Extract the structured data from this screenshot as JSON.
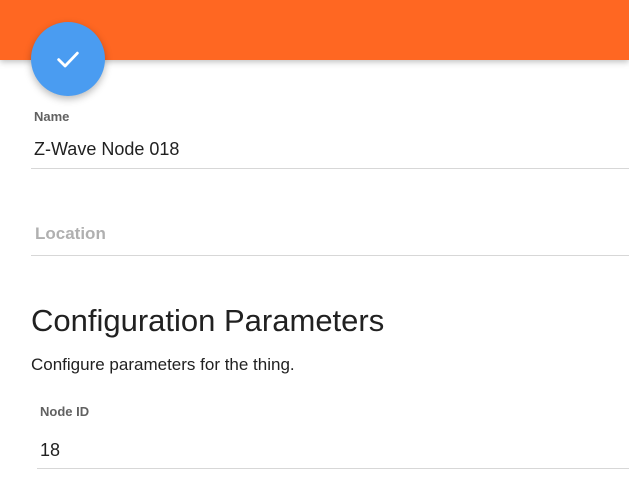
{
  "header": {
    "accent_color": "#ff6722",
    "save_button_icon": "check-icon",
    "save_button_color": "#4a9cf1"
  },
  "form": {
    "name_label": "Name",
    "name_value": "Z-Wave Node 018",
    "location_label": "Location",
    "location_value": ""
  },
  "config": {
    "title": "Configuration Parameters",
    "description": "Configure parameters for the thing.",
    "node_id_label": "Node ID",
    "node_id_value": "18"
  }
}
